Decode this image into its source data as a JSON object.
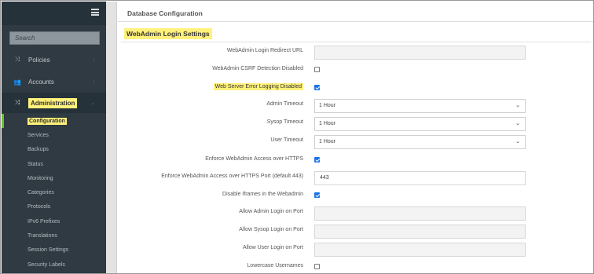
{
  "sidebar": {
    "search_placeholder": "Search",
    "nav": [
      {
        "label": "Policies",
        "icon": "shuffle-icon"
      },
      {
        "label": "Accounts",
        "icon": "users-icon"
      },
      {
        "label": "Administration",
        "icon": "shuffle-icon"
      }
    ],
    "sub_items": [
      "Configuration",
      "Services",
      "Backups",
      "Status",
      "Monitoring",
      "Categories",
      "Protocols",
      "IPv6 Prefixes",
      "Translations",
      "Session Settings",
      "Security Labels"
    ],
    "active_sub": "Configuration"
  },
  "header": {
    "breadcrumb": "Database Configuration"
  },
  "section": {
    "title": "WebAdmin Login Settings"
  },
  "fields": [
    {
      "label": "WebAdmin Login Redirect URL",
      "type": "text",
      "value": ""
    },
    {
      "label": "WebAdmin CSRF Detection Disabled",
      "type": "checkbox",
      "checked": false
    },
    {
      "label": "Web Server Error Logging Disabled",
      "type": "checkbox",
      "checked": true,
      "highlighted": true
    },
    {
      "label": "Admin Timeout",
      "type": "select",
      "value": "1 Hour"
    },
    {
      "label": "Sysop Timeout",
      "type": "select",
      "value": "1 Hour"
    },
    {
      "label": "User Timeout",
      "type": "select",
      "value": "1 Hour"
    },
    {
      "label": "Enforce WebAdmin Access over HTTPS",
      "type": "checkbox",
      "checked": true
    },
    {
      "label": "Enforce WebAdmin Access over HTTPS Port (default 443)",
      "type": "text",
      "value": "443"
    },
    {
      "label": "Disable Iframes in the Webadmin",
      "type": "checkbox",
      "checked": true
    },
    {
      "label": "Allow Admin Login on Port",
      "type": "text",
      "value": ""
    },
    {
      "label": "Allow Sysop Login on Port",
      "type": "text",
      "value": ""
    },
    {
      "label": "Allow User Login on Port",
      "type": "text",
      "value": ""
    },
    {
      "label": "Lowercase Usernames",
      "type": "checkbox",
      "checked": false
    }
  ],
  "colors": {
    "sidebar_bg": "#2f3a42",
    "highlight": "#fff17a",
    "active_bar": "#6cbf2e",
    "checkbox_checked": "#1a73e8"
  }
}
